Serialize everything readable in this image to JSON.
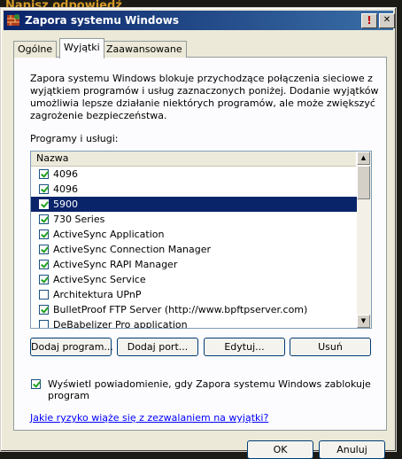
{
  "background": {
    "post_reply_label": "Napisz odpowiedź"
  },
  "window": {
    "title": "Zapora systemu Windows",
    "help_glyph": "!",
    "close_glyph": "✕"
  },
  "tabs": [
    {
      "label": "Ogólne",
      "active": false
    },
    {
      "label": "Wyjątki",
      "active": true
    },
    {
      "label": "Zaawansowane",
      "active": false
    }
  ],
  "description": "Zapora systemu Windows blokuje przychodzące połączenia sieciowe z wyjątkiem programów i usług zaznaczonych poniżej. Dodanie wyjątków umożliwia lepsze działanie niektórych programów, ale może zwiększyć zagrożenie bezpieczeństwa.",
  "programs_label": "Programy i usługi:",
  "list": {
    "column_header": "Nazwa",
    "rows": [
      {
        "label": "4096",
        "checked": true,
        "selected": false
      },
      {
        "label": "4096",
        "checked": true,
        "selected": false
      },
      {
        "label": "5900",
        "checked": true,
        "selected": true
      },
      {
        "label": "730 Series",
        "checked": true,
        "selected": false
      },
      {
        "label": "ActiveSync Application",
        "checked": true,
        "selected": false
      },
      {
        "label": "ActiveSync Connection Manager",
        "checked": true,
        "selected": false
      },
      {
        "label": "ActiveSync RAPI Manager",
        "checked": true,
        "selected": false
      },
      {
        "label": "ActiveSync Service",
        "checked": true,
        "selected": false
      },
      {
        "label": "Architektura UPnP",
        "checked": false,
        "selected": false
      },
      {
        "label": "BulletProof FTP Server (http://www.bpftpserver.com)",
        "checked": true,
        "selected": false
      },
      {
        "label": "DeBabelizer Pro application",
        "checked": false,
        "selected": false
      }
    ]
  },
  "buttons": {
    "add_program": "Dodaj program...",
    "add_port": "Dodaj port...",
    "edit": "Edytuj...",
    "remove": "Usuń",
    "ok": "OK",
    "cancel": "Anuluj"
  },
  "notify": {
    "checked": true,
    "label": "Wyświetl powiadomienie, gdy Zapora systemu Windows zablokuje program"
  },
  "risk_link": "Jakie ryzyko wiąże się z zezwalaniem na wyjątki?",
  "colors": {
    "selection": "#0a246a",
    "title_gradient_start": "#0a246a",
    "title_gradient_end": "#3a6ea5",
    "link": "#0000ff",
    "panel": "#fcfcfe"
  }
}
